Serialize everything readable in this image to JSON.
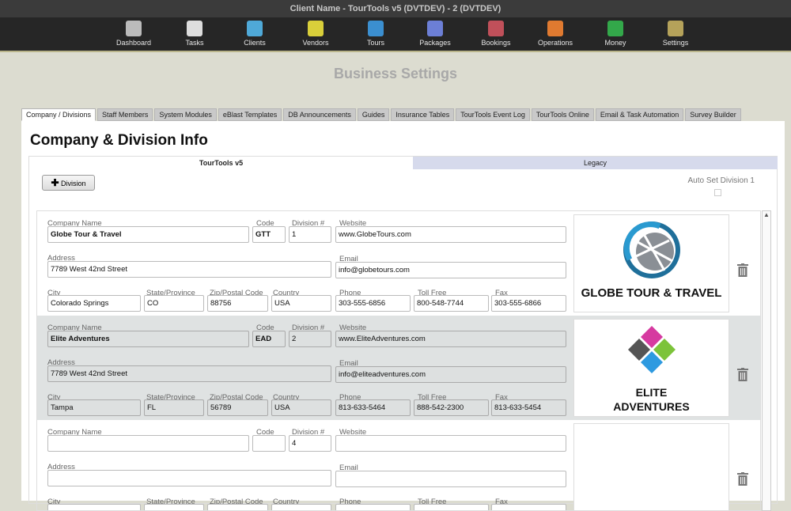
{
  "window_title": "Client Name - TourTools v5 (DVTDEV) - 2 (DVTDEV)",
  "nav": [
    {
      "label": "Dashboard",
      "icon": "dashboard-icon",
      "color": "#bbbbbb"
    },
    {
      "label": "Tasks",
      "icon": "calendar-icon",
      "color": "#dddddd"
    },
    {
      "label": "Clients",
      "icon": "person-icon",
      "color": "#4fa9d8"
    },
    {
      "label": "Vendors",
      "icon": "building-icon",
      "color": "#d9cf3a"
    },
    {
      "label": "Tours",
      "icon": "compass-icon",
      "color": "#3b8fd0"
    },
    {
      "label": "Packages",
      "icon": "puzzle-icon",
      "color": "#6c7fd6"
    },
    {
      "label": "Bookings",
      "icon": "ticket-icon",
      "color": "#c0505a"
    },
    {
      "label": "Operations",
      "icon": "operations-icon",
      "color": "#e07a30"
    },
    {
      "label": "Money",
      "icon": "money-icon",
      "color": "#33a84a"
    },
    {
      "label": "Settings",
      "icon": "gear-icon",
      "color": "#b5a25a"
    }
  ],
  "page_title": "Business Settings",
  "tabs": [
    "Company / Divisions",
    "Staff Members",
    "System Modules",
    "eBlast Templates",
    "DB Announcements",
    "Guides",
    "Insurance Tables",
    "TourTools Event Log",
    "TourTools Online",
    "Email & Task Automation",
    "Survey Builder"
  ],
  "heading": "Company & Division Info",
  "subtabs": [
    "TourTools v5",
    "Legacy"
  ],
  "add_division": "Division",
  "auto_set": "Auto Set Division 1",
  "labels": {
    "company": "Company Name",
    "code": "Code",
    "division": "Division #",
    "website": "Website",
    "address": "Address",
    "email": "Email",
    "city": "City",
    "state": "State/Province",
    "zip": "Zip/Postal Code",
    "country": "Country",
    "phone": "Phone",
    "tollfree": "Toll Free",
    "fax": "Fax"
  },
  "divisions": [
    {
      "company": "Globe Tour & Travel",
      "code": "GTT",
      "division": "1",
      "website": "www.GlobeTours.com",
      "address": "7789 West 42nd Street",
      "email": "info@globetours.com",
      "city": "Colorado Springs",
      "state": "CO",
      "zip": "88756",
      "country": "USA",
      "phone": "303-555-6856",
      "tollfree": "800-548-7744",
      "fax": "303-555-6866",
      "logo_text": [
        "GLOBE TOUR & TRAVEL"
      ]
    },
    {
      "company": "Elite Adventures",
      "code": "EAD",
      "division": "2",
      "website": "www.EliteAdventures.com",
      "address": "7789 West 42nd Street",
      "email": "info@eliteadventures.com",
      "city": "Tampa",
      "state": "FL",
      "zip": "56789",
      "country": "USA",
      "phone": "813-633-5464",
      "tollfree": "888-542-2300",
      "fax": "813-633-5454",
      "logo_text": [
        "ELITE",
        "ADVENTURES"
      ]
    },
    {
      "company": "",
      "code": "",
      "division": "4",
      "website": "",
      "address": "",
      "email": "",
      "city": "",
      "state": "",
      "zip": "",
      "country": "",
      "phone": "",
      "tollfree": "",
      "fax": "",
      "logo_text": []
    }
  ]
}
